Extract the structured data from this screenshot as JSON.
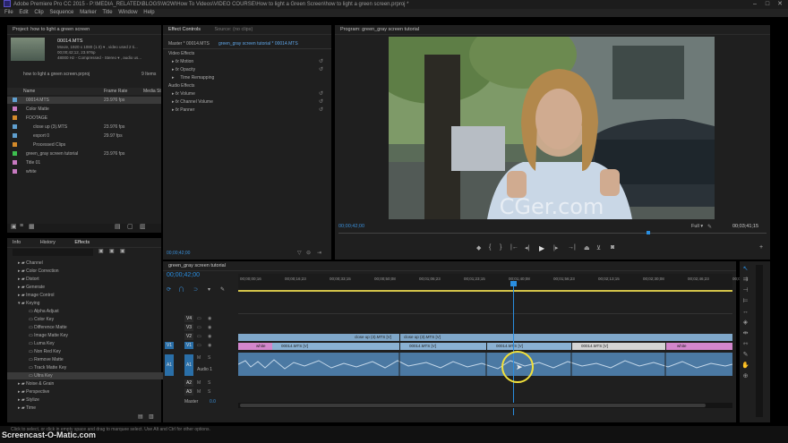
{
  "window": {
    "title": "Adobe Premiere Pro CC 2015 - P:\\MEDIA_RELATED\\BLOGS\\W2W\\How To Videos\\VIDEO COURSE\\How to light a Green Screen\\how to light a green screen.prproj *"
  },
  "menu": [
    "File",
    "Edit",
    "Clip",
    "Sequence",
    "Marker",
    "Title",
    "Window",
    "Help"
  ],
  "project": {
    "tab": "Project: how to light a green screen",
    "clip_name": "00014.MTS",
    "clip_info": [
      "Movie, 1920 x 1080 (1.0)  ▾ , video used 2 ti...",
      "00;00;42;12, 23.976p",
      "48000 Hz - Compressed - Stereo  ▾ , audio us..."
    ],
    "path": "how to light a green screen.prproj",
    "items_count": "9 Items",
    "col_name": "Name",
    "col_rate": "Frame Rate",
    "col_media": "Media St",
    "items": [
      {
        "name": "00014.MTS",
        "rate": "23.976 fps",
        "color": "#5f9fcf",
        "indent": 0,
        "selected": true
      },
      {
        "name": "Color Matte",
        "rate": "",
        "color": "#c779c0",
        "indent": 0
      },
      {
        "name": "FOOTAGE",
        "rate": "",
        "color": "#d48a2a",
        "indent": 0
      },
      {
        "name": "close up (3).MTS",
        "rate": "23.976 fps",
        "color": "#5f9fcf",
        "indent": 1
      },
      {
        "name": "export 0",
        "rate": "29.97 fps",
        "color": "#5f9fcf",
        "indent": 1
      },
      {
        "name": "Processed Clips",
        "rate": "",
        "color": "#d48a2a",
        "indent": 1
      },
      {
        "name": "green_gray screen tutorial",
        "rate": "23.976 fps",
        "color": "#3dbf4f",
        "indent": 0
      },
      {
        "name": "Title 01",
        "rate": "",
        "color": "#c779c0",
        "indent": 0
      },
      {
        "name": "white",
        "rate": "",
        "color": "#c779c0",
        "indent": 0
      }
    ]
  },
  "effects_panel": {
    "tabs": [
      "Info",
      "History",
      "Effects"
    ],
    "items": [
      {
        "label": "Channel",
        "depth": 0
      },
      {
        "label": "Color Correction",
        "depth": 0
      },
      {
        "label": "Distort",
        "depth": 0
      },
      {
        "label": "Generate",
        "depth": 0
      },
      {
        "label": "Image Control",
        "depth": 0
      },
      {
        "label": "Keying",
        "depth": 0,
        "open": true
      },
      {
        "label": "Alpha Adjust",
        "depth": 1
      },
      {
        "label": "Color Key",
        "depth": 1
      },
      {
        "label": "Difference Matte",
        "depth": 1
      },
      {
        "label": "Image Matte Key",
        "depth": 1
      },
      {
        "label": "Luma Key",
        "depth": 1
      },
      {
        "label": "Non Red Key",
        "depth": 1
      },
      {
        "label": "Remove Matte",
        "depth": 1
      },
      {
        "label": "Track Matte Key",
        "depth": 1
      },
      {
        "label": "Ultra Key",
        "depth": 1,
        "selected": true
      },
      {
        "label": "Noise & Grain",
        "depth": 0
      },
      {
        "label": "Perspective",
        "depth": 0
      },
      {
        "label": "Stylize",
        "depth": 0
      },
      {
        "label": "Time",
        "depth": 0
      }
    ]
  },
  "effect_controls": {
    "tab": "Effect Controls",
    "tab2": "Source: (no clips)",
    "master": "Master * 00014.MTS",
    "seq": "green_gray screen tutorial * 00014.MTS",
    "video_effects": "Video Effects",
    "audio_effects": "Audio Effects",
    "video_items": [
      "Motion",
      "Opacity",
      "Time Remapping"
    ],
    "audio_items": [
      "Volume",
      "Channel Volume",
      "Panner"
    ],
    "timecode": "00;00;42;00"
  },
  "program": {
    "tab": "Program: green_gray screen tutorial",
    "timecode_left": "00;00;42;00",
    "timecode_right": "00;03;41;15",
    "zoom": "Full",
    "watermark": "CGer.com"
  },
  "timeline": {
    "tab": "green_gray screen tutorial",
    "timecode": "00;00;42;00",
    "ruler": [
      "00;00;00;16",
      "00;00;16;23",
      "00;00;33;15",
      "00;00;50;08",
      "00;01;06;23",
      "00;01;23;15",
      "00;01;40;08",
      "00;01;56;23",
      "00;02;13;15",
      "00;02;30;08",
      "00;02;46;23",
      "00;03;03;15"
    ],
    "tracks": {
      "v": [
        "V4",
        "V3",
        "V2",
        "V1"
      ],
      "a": [
        "A1",
        "A2",
        "A3"
      ],
      "master": "Master",
      "master_val": "0.0",
      "audio_label": "Audio 1"
    },
    "clips_v2": [
      "close up (3).MTS [V]",
      "close up (3).MTS [V]"
    ],
    "clips_v1": [
      "white",
      "00014.MTS [V]",
      "00014.MTS [V]",
      "00014.MTS [V]",
      "00014.MTS [V]",
      "white"
    ]
  },
  "status": {
    "hint": "Click to select, or click in empty space and drag to marquee select. Use Alt and Ctrl for other options.",
    "watermark": "Screencast-O-Matic.com"
  },
  "colors": {
    "accent": "#2a8ee0",
    "video_clip": "#8ab1d3",
    "pink_clip": "#d386cc",
    "audio_clip": "#4b79a3"
  }
}
